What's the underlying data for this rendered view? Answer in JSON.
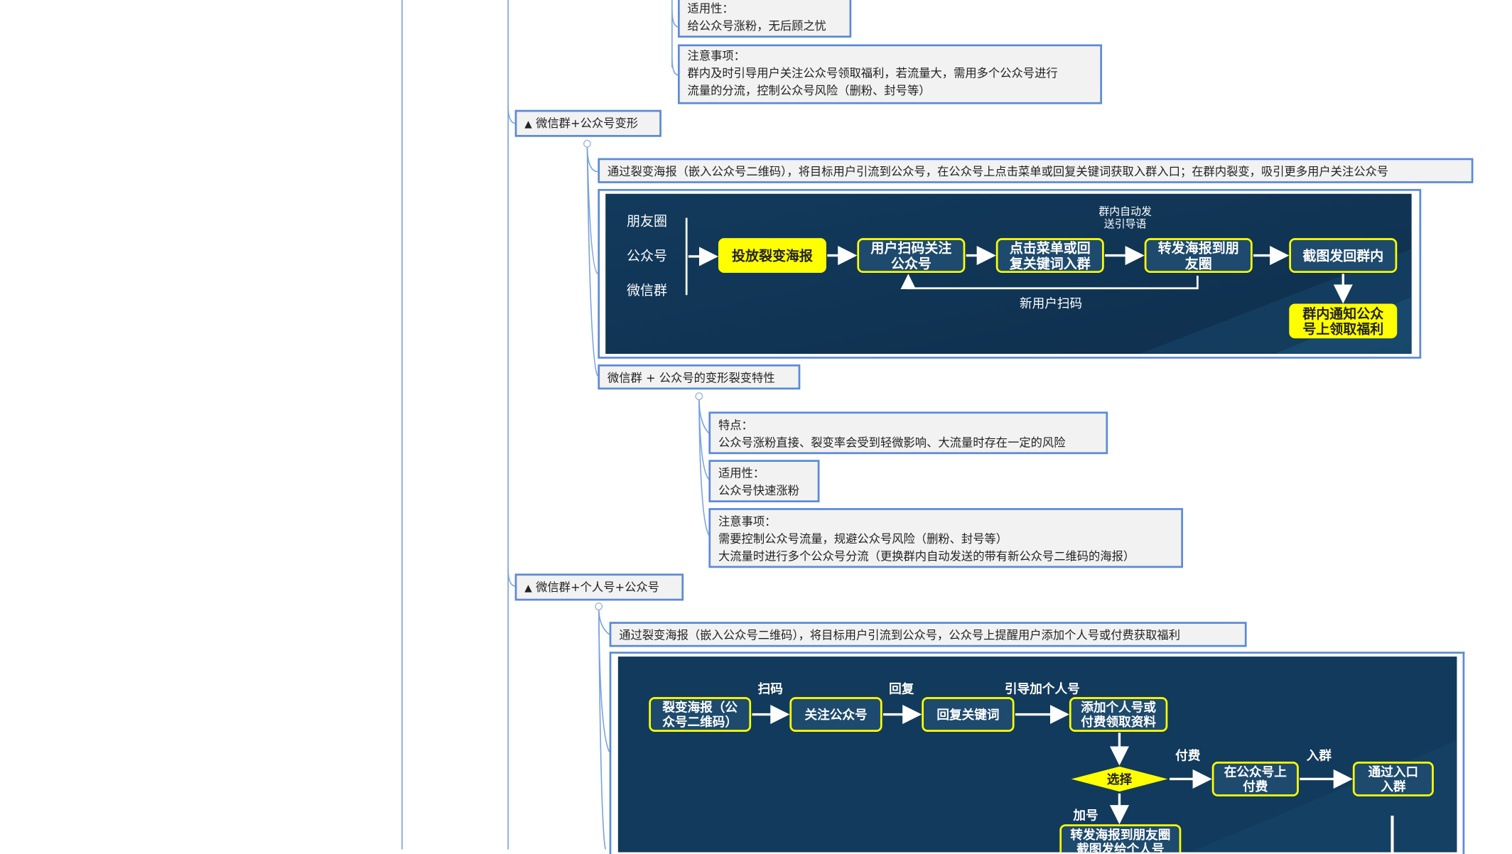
{
  "top_node_1": {
    "label": "适用性：",
    "text": "给公众号涨粉，无后顾之忧"
  },
  "top_node_2": {
    "label": "注意事项：",
    "text1": "群内及时引导用户关注公众号领取福利，若流量大，需用多个公众号进行",
    "text2": "流量的分流，控制公众号风险（删粉、封号等）"
  },
  "topic_1": {
    "title": "微信群+公众号变形",
    "desc": "通过裂变海报（嵌入公众号二维码），将目标用户引流到公众号，在公众号上点击菜单或回复关键词获取入群入口；在群内裂变，吸引更多用户关注公众号",
    "flow": {
      "sources": [
        "朋友圈",
        "公众号",
        "微信群"
      ],
      "steps": [
        "投放裂变海报",
        "用户扫码关注|公众号",
        "点击菜单或回|复关键词入群",
        "转发海报到朋|友圈",
        "截图发回群内",
        "群内通知公众|号上领取福利"
      ],
      "note_top": "群内自动发|送引导语",
      "note_loop": "新用户扫码"
    },
    "sub_title": "微信群 + 公众号的变形裂变特性",
    "feature": {
      "label": "特点：",
      "text": "公众号涨粉直接、裂变率会受到轻微影响、大流量时存在一定的风险"
    },
    "applicability": {
      "label": "适用性：",
      "text": "公众号快速涨粉"
    },
    "notes": {
      "label": "注意事项：",
      "text1": "需要控制公众号流量，规避公众号风险（删粉、封号等）",
      "text2": "大流量时进行多个公众号分流（更换群内自动发送的带有新公众号二维码的海报）"
    }
  },
  "topic_2": {
    "title": "微信群+个人号+公众号",
    "desc": "通过裂变海报（嵌入公众号二维码），将目标用户引流到公众号，公众号上提醒用户添加个人号或付费获取福利",
    "flow": {
      "steps": [
        "裂变海报（公|众号二维码）",
        "关注公众号",
        "回复关键词",
        "添加个人号或|付费领取资料",
        "选择",
        "在公众号上|付费",
        "通过入口|入群",
        "转发海报到朋友圈|截图发给个人号"
      ],
      "labels": [
        "扫码",
        "回复",
        "引导加个人号",
        "付费",
        "入群",
        "加号"
      ]
    }
  },
  "colors": {
    "border": "#5b8bd6",
    "panel_bg": "#123a5c",
    "yellow": "#ffff00",
    "node_fill": "#1e4a6e"
  }
}
